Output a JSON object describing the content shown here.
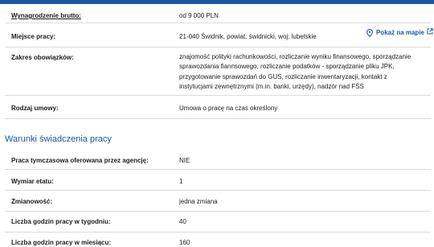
{
  "colors": {
    "accent": "#1a56a8",
    "divider": "#dcdcdc",
    "text": "#1b1b1b"
  },
  "offer_details": {
    "rows": [
      {
        "label": "Wynagrodzenie brutto:",
        "value": "od 9 000 PLN"
      },
      {
        "label": "Miejsce pracy:",
        "value": "21-040 Świdnik, powiat: świdnicki, woj: lubelskie"
      },
      {
        "label": "Zakres obowiązków:",
        "value": "znajomość polityki rachunkowości, rozliczanie wyniku finansowego, sporządzanie sprawozdania fiannsowego, rozliczanie podatków - sporządzanie pliku JPK, przygotowanie sprawozdań do GUS, rozliczanie inwentaryzacji, kontakt z instytucjami zewnętrznymi (m.in. banki, urzędy), nadzór nad FŚS"
      },
      {
        "label": "Rodzaj umowy:",
        "value": "Umowa o pracę na czas określony"
      }
    ],
    "map_link": {
      "label": "Pokaż na mapie",
      "pin_icon": "map-pin-icon",
      "external_icon": "external-link-icon"
    }
  },
  "conditions": {
    "title": "Warunki świadczenia pracy",
    "rows": [
      {
        "label": "Praca tymczasowa oferowana przez agencję:",
        "value": "NIE"
      },
      {
        "label": "Wymiar etatu:",
        "value": "1"
      },
      {
        "label": "Zmianowość:",
        "value": "jedna zmiana"
      },
      {
        "label": "Liczba godzin pracy w tygodniu:",
        "value": "40"
      },
      {
        "label": "Liczba godzin pracy w miesiącu:",
        "value": "160"
      }
    ]
  }
}
